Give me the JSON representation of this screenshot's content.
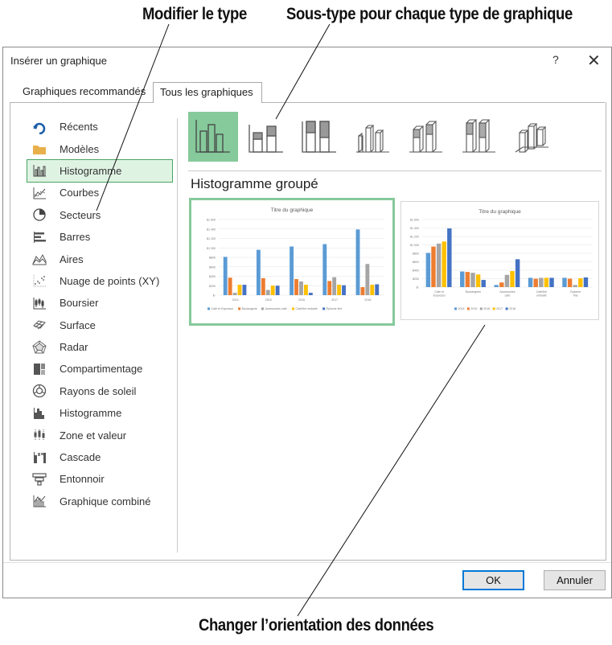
{
  "callouts": {
    "type": "Modifier le type",
    "subtype": "Sous-type pour chaque type de graphique",
    "orientation": "Changer l’orientation des données"
  },
  "dialog": {
    "title": "Insérer un graphique",
    "help": "?",
    "close": "✕",
    "tabs": {
      "recommended": "Graphiques recommandés",
      "all": "Tous les graphiques"
    },
    "ok_label": "OK",
    "cancel_label": "Annuler"
  },
  "sidebar": {
    "items": [
      {
        "label": "Récents",
        "icon": "recent-icon"
      },
      {
        "label": "Modèles",
        "icon": "folder-icon"
      },
      {
        "label": "Histogramme",
        "icon": "column-chart-icon",
        "selected": true
      },
      {
        "label": "Courbes",
        "icon": "line-chart-icon"
      },
      {
        "label": "Secteurs",
        "icon": "pie-chart-icon"
      },
      {
        "label": "Barres",
        "icon": "bar-chart-icon"
      },
      {
        "label": "Aires",
        "icon": "area-chart-icon"
      },
      {
        "label": "Nuage de points (XY)",
        "icon": "scatter-chart-icon"
      },
      {
        "label": "Boursier",
        "icon": "stock-chart-icon"
      },
      {
        "label": "Surface",
        "icon": "surface-chart-icon"
      },
      {
        "label": "Radar",
        "icon": "radar-chart-icon"
      },
      {
        "label": "Compartimentage",
        "icon": "treemap-chart-icon"
      },
      {
        "label": "Rayons de soleil",
        "icon": "sunburst-chart-icon"
      },
      {
        "label": "Histogramme",
        "icon": "histogram-chart-icon"
      },
      {
        "label": "Zone et valeur",
        "icon": "box-whisker-chart-icon"
      },
      {
        "label": "Cascade",
        "icon": "waterfall-chart-icon"
      },
      {
        "label": "Entonnoir",
        "icon": "funnel-chart-icon"
      },
      {
        "label": "Graphique combiné",
        "icon": "combo-chart-icon"
      }
    ]
  },
  "subtypes": [
    {
      "icon": "clustered-column-icon",
      "selected": true
    },
    {
      "icon": "stacked-column-icon"
    },
    {
      "icon": "100-stacked-column-icon"
    },
    {
      "icon": "3d-clustered-column-icon"
    },
    {
      "icon": "3d-stacked-column-icon"
    },
    {
      "icon": "3d-100-stacked-column-icon"
    },
    {
      "icon": "3d-column-icon"
    }
  ],
  "subtype_title": "Histogramme groupé",
  "colors": {
    "accent_green": "#86c99b",
    "series": [
      "#5b9bd5",
      "#ed7d31",
      "#a5a5a5",
      "#ffc000",
      "#4472c4"
    ]
  },
  "chart_data": [
    {
      "type": "bar",
      "title": "Titre du graphique",
      "categories": [
        "2014",
        "2015",
        "2016",
        "2017",
        "2018"
      ],
      "ylim": [
        0,
        1600
      ],
      "yticks": [
        "$-",
        "$200",
        "$400",
        "$600",
        "$800",
        "$1 000",
        "$1 200",
        "$1 400",
        "$1 600"
      ],
      "series": [
        {
          "name": "Café et Expresso",
          "values": [
            810,
            960,
            1030,
            1080,
            1390
          ]
        },
        {
          "name": "Boulangerie",
          "values": [
            370,
            360,
            340,
            300,
            170
          ]
        },
        {
          "name": "Accessoires café",
          "values": [
            50,
            110,
            290,
            380,
            660
          ]
        },
        {
          "name": "Café/thé emballé",
          "values": [
            220,
            200,
            220,
            220,
            220
          ]
        },
        {
          "name": "Épicerie fine",
          "values": [
            220,
            200,
            50,
            210,
            230
          ]
        }
      ]
    },
    {
      "type": "bar",
      "title": "Titre du graphique",
      "categories": [
        "Café et Expresso",
        "Boulangerie",
        "Accessoires café",
        "Café/thé emballé",
        "Épicerie fine"
      ],
      "ylim": [
        0,
        1600
      ],
      "yticks": [
        "$-",
        "$200",
        "$400",
        "$600",
        "$800",
        "$1 000",
        "$1 200",
        "$1 400",
        "$1 600"
      ],
      "series": [
        {
          "name": "2014",
          "values": [
            810,
            370,
            50,
            220,
            220
          ]
        },
        {
          "name": "2015",
          "values": [
            960,
            360,
            110,
            200,
            200
          ]
        },
        {
          "name": "2016",
          "values": [
            1030,
            340,
            290,
            220,
            50
          ]
        },
        {
          "name": "2017",
          "values": [
            1080,
            300,
            380,
            220,
            210
          ]
        },
        {
          "name": "2018",
          "values": [
            1390,
            170,
            660,
            220,
            230
          ]
        }
      ]
    }
  ]
}
